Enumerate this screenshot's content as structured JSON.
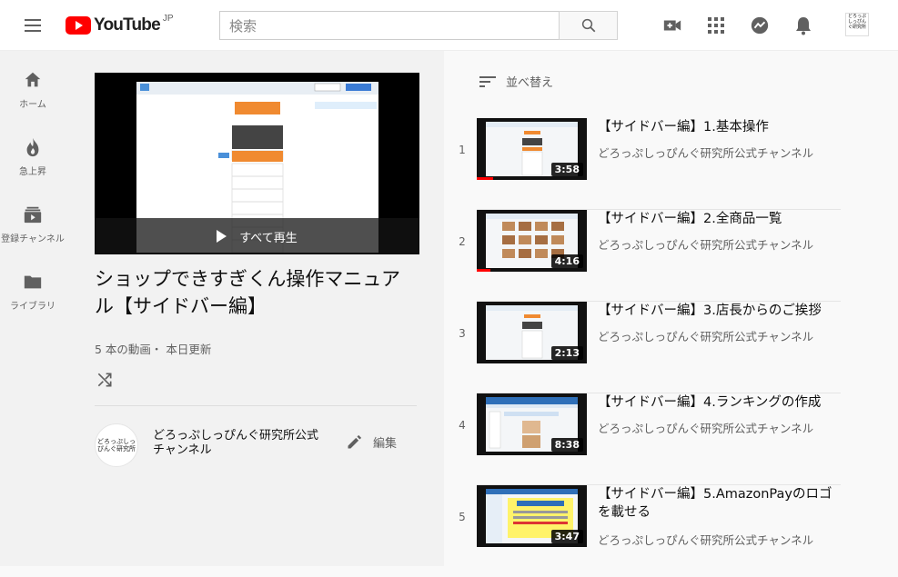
{
  "header": {
    "logo_text": "YouTube",
    "logo_region": "JP",
    "search_placeholder": "検索",
    "icons": [
      "menu-icon",
      "search-icon",
      "create-video-icon",
      "apps-grid-icon",
      "messages-icon",
      "notifications-bell-icon"
    ],
    "avatar_text": "どろっぷしっぴんぐ研究所"
  },
  "sidebar": {
    "items": [
      {
        "label": "ホーム",
        "icon": "home-icon"
      },
      {
        "label": "急上昇",
        "icon": "trending-flame-icon"
      },
      {
        "label": "登録チャンネル",
        "icon": "subscriptions-icon"
      },
      {
        "label": "ライブラリ",
        "icon": "library-folder-icon"
      }
    ]
  },
  "playlist": {
    "play_all_label": "すべて再生",
    "title": "ショップできすぎくん操作マニュアル【サイドバー編】",
    "meta": "5 本の動画・ 本日更新",
    "owner_name": "どろっぷしっぴんぐ研究所公式チャンネル",
    "owner_avatar_text": "どろっぷしっぴんぐ研究所",
    "edit_label": "編集"
  },
  "list": {
    "sort_label": "並べ替え",
    "videos": [
      {
        "index": "1",
        "title": "【サイドバー編】1.基本操作",
        "channel": "どろっぷしっぴんぐ研究所公式チャンネル",
        "duration": "3:58",
        "watched": 0.15
      },
      {
        "index": "2",
        "title": "【サイドバー編】2.全商品一覧",
        "channel": "どろっぷしっぴんぐ研究所公式チャンネル",
        "duration": "4:16",
        "watched": 0.12
      },
      {
        "index": "3",
        "title": "【サイドバー編】3.店長からのご挨拶",
        "channel": "どろっぷしっぴんぐ研究所公式チャンネル",
        "duration": "2:13",
        "watched": 0
      },
      {
        "index": "4",
        "title": "【サイドバー編】4.ランキングの作成",
        "channel": "どろっぷしっぴんぐ研究所公式チャンネル",
        "duration": "8:38",
        "watched": 0
      },
      {
        "index": "5",
        "title": "【サイドバー編】5.AmazonPayのロゴを載せる",
        "channel": "どろっぷしっぴんぐ研究所公式チャンネル",
        "duration": "3:47",
        "watched": 0
      }
    ]
  }
}
